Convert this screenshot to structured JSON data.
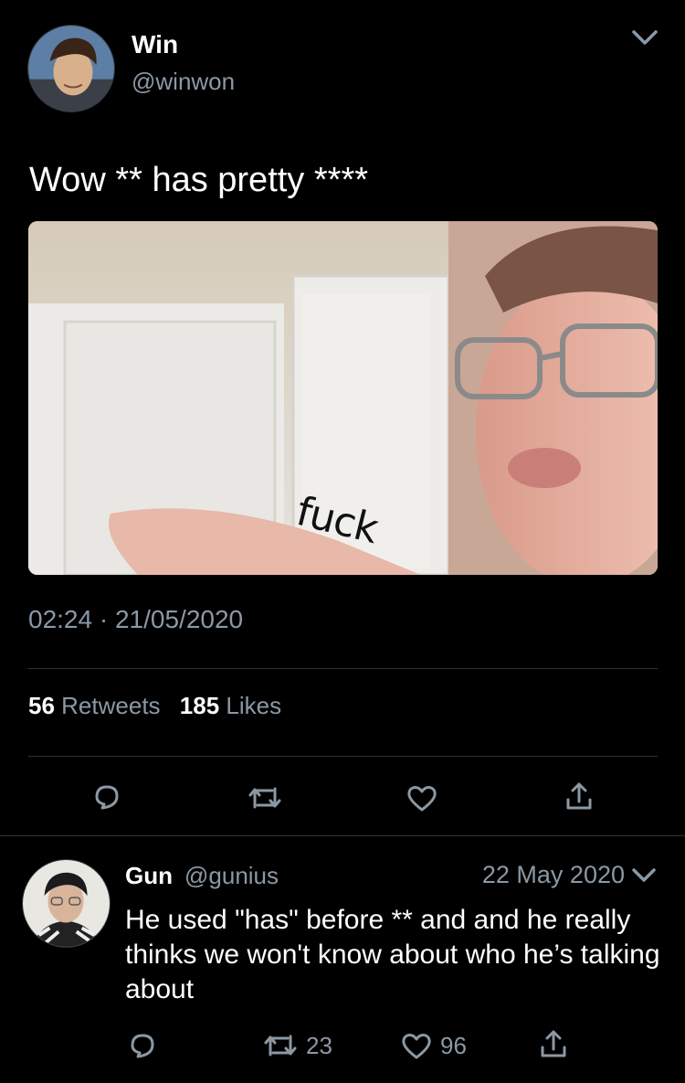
{
  "tweet": {
    "author_name": "Win",
    "author_handle": "@winwon",
    "text": "Wow ** has pretty ****",
    "media_caption": "fuck",
    "time": "02:24",
    "date": "21/05/2020",
    "retweets_count": "56",
    "retweets_label": "Retweets",
    "likes_count": "185",
    "likes_label": "Likes"
  },
  "reply": {
    "author_name": "Gun",
    "author_handle": "@gunius",
    "date": "22 May 2020",
    "text": "He used \"has\" before ** and and he really thinks we won't know about who he’s talking about",
    "retweets_count": "23",
    "likes_count": "96"
  },
  "icons": {
    "reply": "reply-icon",
    "retweet": "retweet-icon",
    "like": "heart-icon",
    "share": "share-icon",
    "menu": "chevron-down-icon"
  },
  "colors": {
    "background": "#000000",
    "secondary_text": "#8b98a5",
    "divider": "#2f3336"
  }
}
